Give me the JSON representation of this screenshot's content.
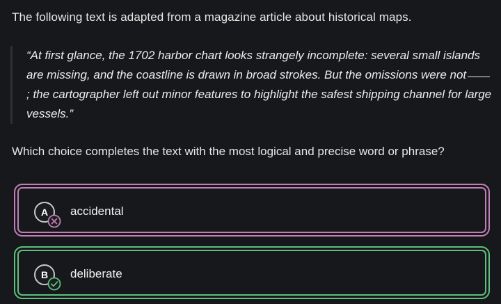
{
  "intro": "The following text is adapted from a magazine article about historical maps.",
  "quote": {
    "part1": "“At first glance, the 1702 harbor chart looks strangely incomplete: several small islands are missing, and the coastline is drawn in broad strokes. But the omissions were not",
    "part2": "; the cartographer left out minor features to highlight the safest shipping channel for large vessels.”"
  },
  "question": "Which choice completes the text with the most logical and precise word or phrase?",
  "choices": [
    {
      "letter": "A",
      "label": "accidental",
      "status": "incorrect",
      "status_icon": "x-circle-icon",
      "color": "#c17fb6"
    },
    {
      "letter": "B",
      "label": "deliberate",
      "status": "correct",
      "status_icon": "check-circle-icon",
      "color": "#5fbf7f"
    }
  ],
  "colors": {
    "background": "#17181b",
    "incorrect": "#c17fb6",
    "correct": "#5fbf7f"
  }
}
